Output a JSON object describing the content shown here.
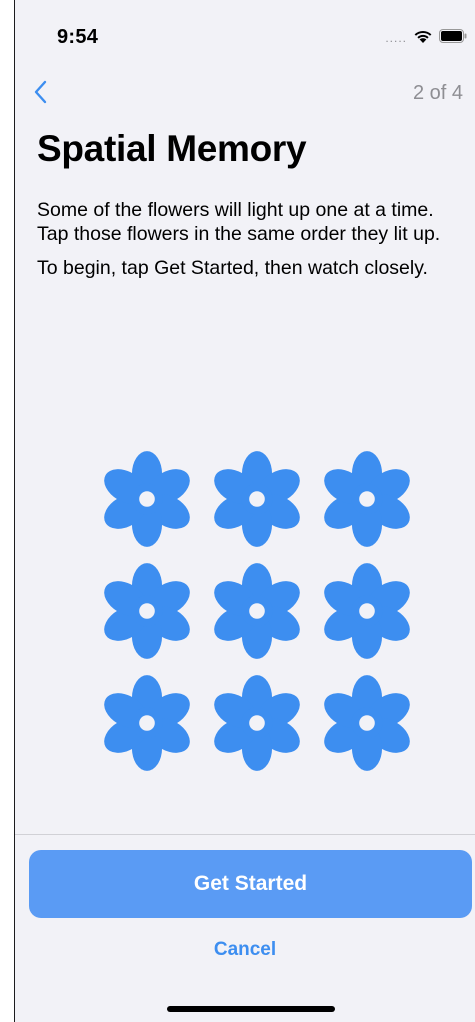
{
  "status_bar": {
    "time": "9:54",
    "signal": "....."
  },
  "nav": {
    "page_indicator": "2 of 4"
  },
  "title": "Spatial Memory",
  "instructions": [
    "Some of the flowers will light up one at a time. Tap those flowers in the same order they lit up.",
    "To begin, tap Get Started, then watch closely."
  ],
  "flowers": {
    "rows": 3,
    "columns": 3,
    "count": 9,
    "icon": "flower-icon"
  },
  "buttons": {
    "primary": "Get Started",
    "cancel": "Cancel"
  },
  "colors": {
    "accent": "#3d8ef0",
    "flower": "#3d8ef0",
    "primary_button": "#5a9bf4",
    "background": "#f2f2f7"
  }
}
